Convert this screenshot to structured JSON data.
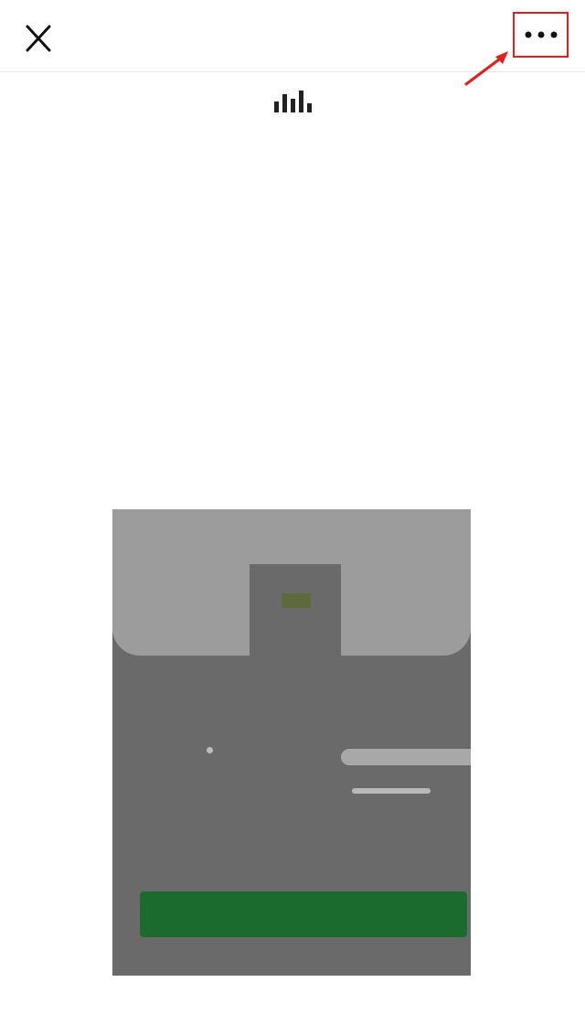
{
  "header": {
    "title": " ",
    "close_icon": "close-icon",
    "more_icon": "more-dots-icon",
    "highlight_color": "#e02020"
  },
  "listen": {
    "icon": "audio-bars-icon"
  },
  "article": {
    "paragraphs": [
      " \n ",
      " \n \n \n "
    ]
  },
  "poster": {
    "button_label": " ",
    "button_color": "#1b6b2e",
    "caption": " "
  },
  "footer": {
    "text": " "
  }
}
